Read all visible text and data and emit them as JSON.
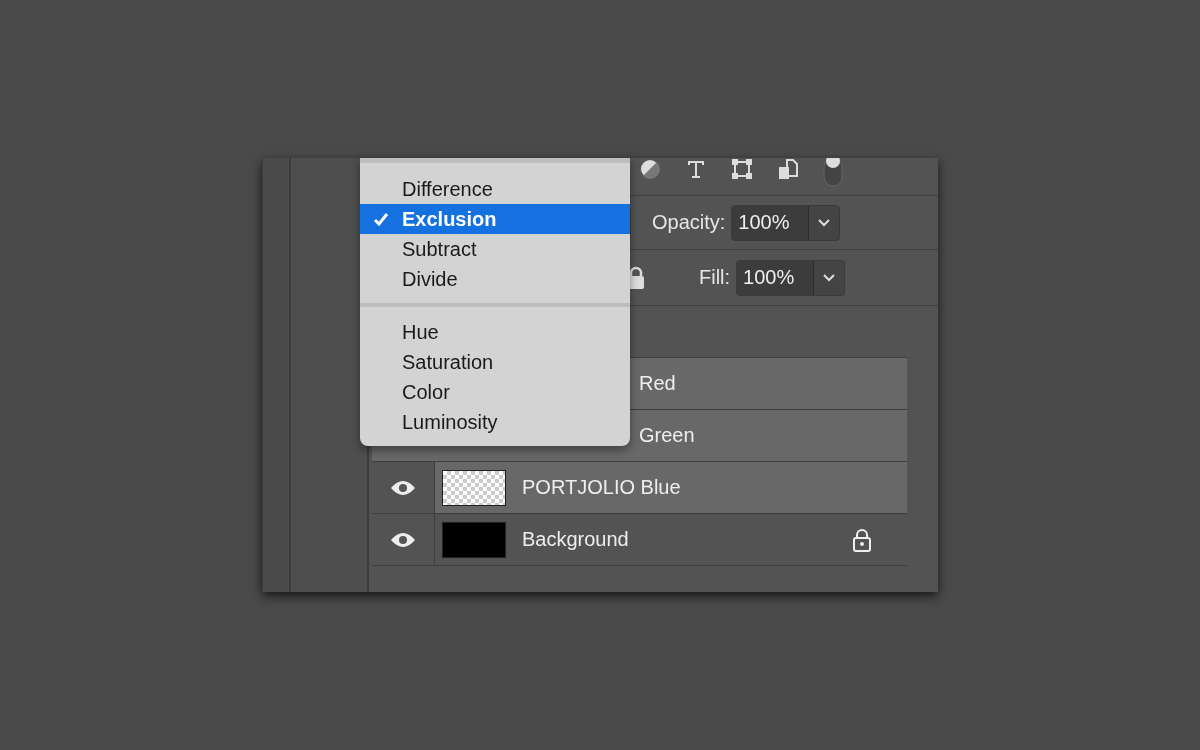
{
  "blend_menu": {
    "groups": [
      {
        "items": [
          {
            "label": "Difference",
            "selected": false
          },
          {
            "label": "Exclusion",
            "selected": true
          },
          {
            "label": "Subtract",
            "selected": false
          },
          {
            "label": "Divide",
            "selected": false
          }
        ]
      },
      {
        "items": [
          {
            "label": "Hue",
            "selected": false
          },
          {
            "label": "Saturation",
            "selected": false
          },
          {
            "label": "Color",
            "selected": false
          },
          {
            "label": "Luminosity",
            "selected": false
          }
        ]
      }
    ]
  },
  "opacity": {
    "label": "Opacity:",
    "value": "100%"
  },
  "fill": {
    "label": "Fill:",
    "value": "100%"
  },
  "layers": [
    {
      "selected": false
    },
    {
      "name": "Red",
      "covered": true,
      "selected": true
    },
    {
      "name": "Green",
      "covered": true,
      "selected": true
    },
    {
      "name": "PORTJOLIO Blue",
      "covered": false,
      "selected": true,
      "visible": true,
      "kind": "checker",
      "locked": false
    },
    {
      "name": "Background",
      "covered": false,
      "selected": false,
      "visible": true,
      "kind": "solid",
      "locked": true
    }
  ]
}
